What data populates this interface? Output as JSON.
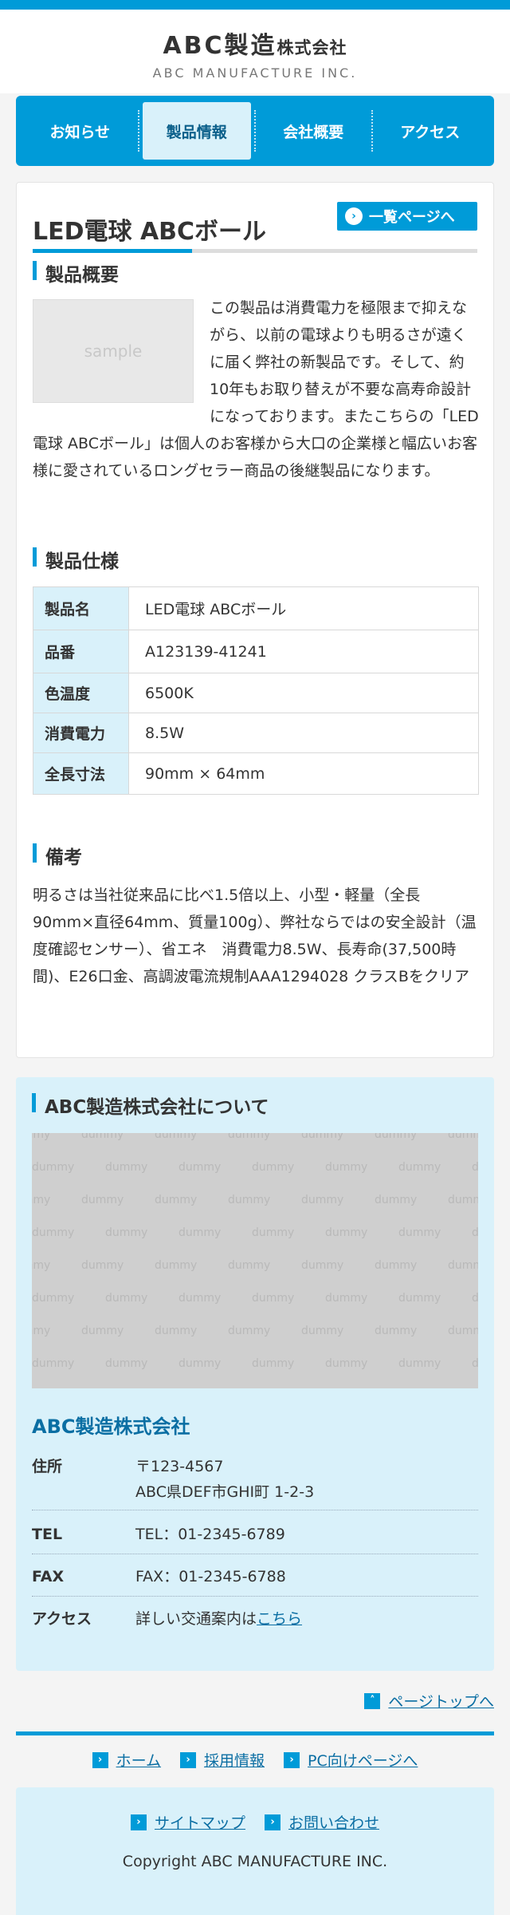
{
  "header": {
    "logo_main": "ABC製造",
    "logo_small": "株式会社",
    "logo_sub": "ABC MANUFACTURE INC."
  },
  "nav": {
    "items": [
      {
        "label": "お知らせ"
      },
      {
        "label": "製品情報"
      },
      {
        "label": "会社概要"
      },
      {
        "label": "アクセス"
      }
    ]
  },
  "product": {
    "title": "LED電球 ABCボール",
    "list_button": "一覧ページへ",
    "overview_heading": "製品概要",
    "sample_label": "sample",
    "overview_text": "この製品は消費電力を極限まで抑えながら、以前の電球よりも明るさが遠くに届く弊社の新製品です。そして、約10年もお取り替えが不要な高寿命設計になっております。またこちらの「LED電球 ABCボール」は個人のお客様から大口の企業様と幅広いお客様に愛されているロングセラー商品の後継製品になります。",
    "spec_heading": "製品仕様",
    "specs": [
      {
        "label": "製品名",
        "value": "LED電球 ABCボール"
      },
      {
        "label": "品番",
        "value": "A123139-41241"
      },
      {
        "label": "色温度",
        "value": "6500K"
      },
      {
        "label": "消費電力",
        "value": "8.5W"
      },
      {
        "label": "全長寸法",
        "value": "90mm × 64mm"
      }
    ],
    "note_heading": "備考",
    "note_text": "明るさは当社従来品に比べ1.5倍以上、小型・軽量（全長90mm×直径64mm、質量100g）、弊社ならではの安全設計（温度確認センサー）、省エネ　消費電力8.5W、長寿命(37,500時間)、E26口金、高調波電流規制AAA1294028 クラスBをクリア"
  },
  "company": {
    "heading": "ABC製造株式会社について",
    "map_placeholder": "dummy",
    "name": "ABC製造株式会社",
    "address_label": "住所",
    "address_line1": "〒123-4567",
    "address_line2": "ABC県DEF市GHI町 1-2-3",
    "tel_label": "TEL",
    "tel_value": "TEL：01-2345-6789",
    "fax_label": "FAX",
    "fax_value": "FAX：01-2345-6788",
    "access_label": "アクセス",
    "access_text": "詳しい交通案内は",
    "access_link": "こちら"
  },
  "footer": {
    "page_top": "ページトップへ",
    "links": [
      "ホーム",
      "採用情報",
      "PC向けページへ"
    ],
    "sub_links": [
      "サイトマップ",
      "お問い合わせ"
    ],
    "copyright": "Copyright ABC MANUFACTURE INC."
  },
  "colors": {
    "accent": "#009bd8",
    "light": "#d9f1fa",
    "link": "#0a6ea3"
  }
}
